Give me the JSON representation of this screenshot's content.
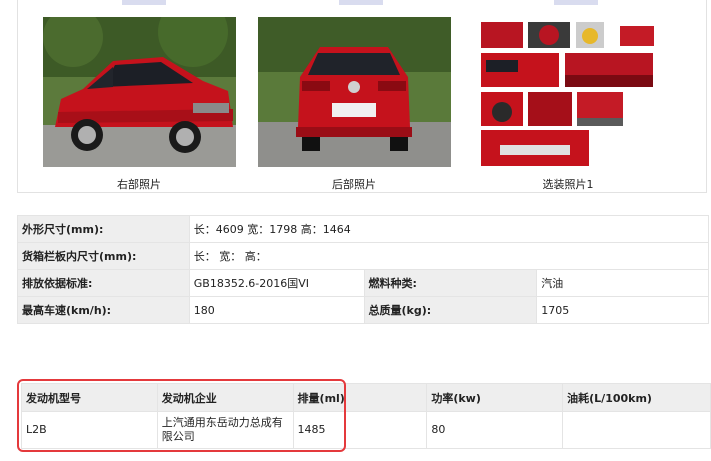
{
  "photos": {
    "captions": [
      "右部照片",
      "后部照片",
      "选装照片1"
    ]
  },
  "colors": {
    "car_red": "#c5121c",
    "highlight_red": "#e4393c",
    "label_bg": "#eeeeee"
  },
  "specs": {
    "rows": [
      [
        {
          "label": "外形尺寸(mm):",
          "value": "长：4609 宽：1798 高：1464"
        }
      ],
      [
        {
          "label": "货箱栏板内尺寸(mm):",
          "value": "长：  宽：  高："
        }
      ],
      [
        {
          "label": "排放依据标准:",
          "value": "GB18352.6-2016国VI"
        },
        {
          "label": "燃料种类:",
          "value": "汽油"
        }
      ],
      [
        {
          "label": "最高车速(km/h):",
          "value": "180"
        },
        {
          "label": "总质量(kg):",
          "value": "1705"
        }
      ]
    ]
  },
  "engine": {
    "headers": [
      "发动机型号",
      "发动机企业",
      "排量(ml)",
      "功率(kw)",
      "油耗(L/100km)"
    ],
    "row": [
      "L2B",
      "上汽通用东岳动力总成有限公司",
      "1485",
      "80",
      ""
    ]
  }
}
